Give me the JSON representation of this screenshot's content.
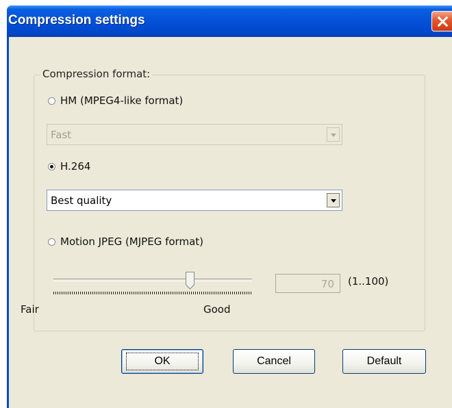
{
  "window": {
    "title": "Compression settings"
  },
  "group": {
    "legend": "Compression format:",
    "options": [
      {
        "label": "HM (MPEG4-like format)",
        "checked": false,
        "combo_value": "Fast",
        "combo_enabled": false
      },
      {
        "label": "H.264",
        "checked": true,
        "combo_value": "Best quality",
        "combo_enabled": true
      },
      {
        "label": "Motion JPEG (MJPEG format)",
        "checked": false
      }
    ],
    "quality": {
      "value": "70",
      "range_label": "(1..100)",
      "min_label": "Fair",
      "max_label": "Good",
      "enabled": false
    }
  },
  "buttons": {
    "ok": "OK",
    "cancel": "Cancel",
    "default": "Default"
  }
}
